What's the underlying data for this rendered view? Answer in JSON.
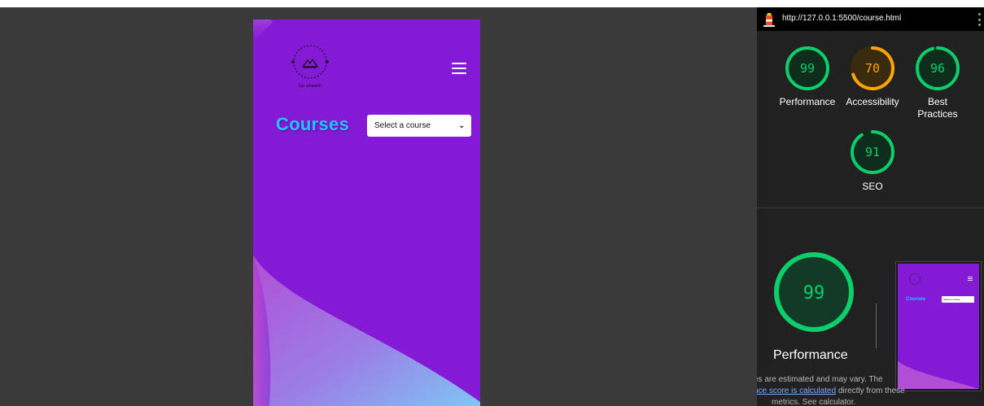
{
  "preview": {
    "page_title": "Courses",
    "select": {
      "value": "Select a course"
    },
    "logo": {
      "tagline": "Go ahead!"
    }
  },
  "lighthouse": {
    "url": "http://127.0.0.1:5500/course.html",
    "gauges": [
      {
        "label": "Performance",
        "score": "99",
        "value": 0.99,
        "color": "#0cce6b"
      },
      {
        "label": "Accessibility",
        "score": "70",
        "value": 0.7,
        "color": "#ffa400"
      },
      {
        "label": "Best Practices",
        "score": "96",
        "value": 0.96,
        "color": "#0cce6b"
      },
      {
        "label": "SEO",
        "score": "91",
        "value": 0.91,
        "color": "#0cce6b"
      }
    ],
    "performance": {
      "score": "99",
      "value": 0.99,
      "label": "Performance",
      "desc_line1": "es are estimated and may vary. The",
      "desc_link": "nce score is calculated",
      "desc_line2_rest": " directly from these",
      "desc_line3": "metrics. See calculator."
    },
    "thumbnail": {
      "title": "Courses",
      "select": "Select a course"
    }
  },
  "colors": {
    "brand_purple": "#851ad6",
    "title_cyan": "#1fc7ff",
    "pass_green": "#0cce6b",
    "average_orange": "#ffa400"
  }
}
